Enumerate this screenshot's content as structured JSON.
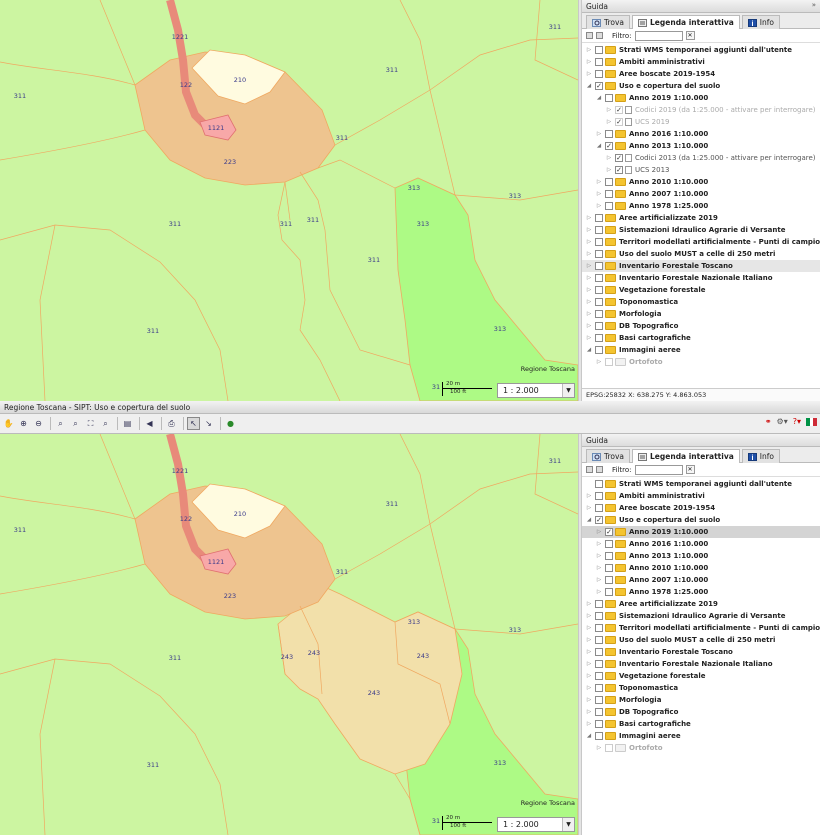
{
  "app_title": "Regione Toscana - SIPT: Uso e copertura del suolo",
  "panel": {
    "title": "Guida",
    "collapse_glyph": "»",
    "tabs": [
      {
        "label": "Trova",
        "icon": "search-icon"
      },
      {
        "label": "Legenda interattiva",
        "icon": "legend-icon",
        "active": true
      },
      {
        "label": "Info",
        "icon": "info-icon"
      }
    ],
    "filter_label": "Filtro:",
    "filter_value": ""
  },
  "map": {
    "credit": "Regione Toscana",
    "scale_m": "20 m",
    "scale_ft": "100 ft",
    "scale_value": "1 : 2.000",
    "colors": {
      "background": "#ccf5a1",
      "code_311": "#ccf5a1",
      "code_313": "#adfa85",
      "code_223": "#eec48f",
      "code_210": "#fffbe0",
      "code_1121": "#f8a8a8",
      "code_122": "#e88a7a",
      "code_243": "#f2e0aa",
      "border": "#f0a860"
    }
  },
  "top": {
    "map_codes": [
      "1221",
      "122",
      "210",
      "1121",
      "223",
      "311",
      "311",
      "311",
      "311",
      "311",
      "311",
      "311",
      "311",
      "311",
      "313",
      "313",
      "313",
      "31"
    ],
    "tree": [
      {
        "label": "Strati WMS temporanei aggiunti dall'utente",
        "level": 0,
        "exp": "▷",
        "check": false
      },
      {
        "label": "Ambiti amministrativi",
        "level": 0,
        "exp": "▷",
        "check": false
      },
      {
        "label": "Aree boscate 2019-1954",
        "level": 0,
        "exp": "▷",
        "check": false
      },
      {
        "label": "Uso e copertura del suolo",
        "level": 0,
        "exp": "◢",
        "check": true
      },
      {
        "label": "Anno 2019 1:10.000",
        "level": 1,
        "exp": "◢",
        "check": false
      },
      {
        "label": "Codici 2019 (da 1:25.000 - attivare per interrogare)",
        "level": 2,
        "exp": "▷",
        "check": true,
        "sub": true,
        "grey": true,
        "doc": true
      },
      {
        "label": "UCS 2019",
        "level": 2,
        "exp": "▷",
        "check": true,
        "sub": true,
        "grey": true,
        "doc": true
      },
      {
        "label": "Anno 2016 1:10.000",
        "level": 1,
        "exp": "▷",
        "check": false
      },
      {
        "label": "Anno 2013 1:10.000",
        "level": 1,
        "exp": "◢",
        "check": true
      },
      {
        "label": "Codici 2013 (da 1:25.000 - attivare per interrogare)",
        "level": 2,
        "exp": "▷",
        "check": true,
        "sub": true,
        "doc": true
      },
      {
        "label": "UCS 2013",
        "level": 2,
        "exp": "▷",
        "check": true,
        "sub": true,
        "doc": true
      },
      {
        "label": "Anno 2010 1:10.000",
        "level": 1,
        "exp": "▷",
        "check": false
      },
      {
        "label": "Anno 2007 1:10.000",
        "level": 1,
        "exp": "▷",
        "check": false
      },
      {
        "label": "Anno 1978 1:25.000",
        "level": 1,
        "exp": "▷",
        "check": false
      },
      {
        "label": "Aree artificializzate 2019",
        "level": 0,
        "exp": "▷",
        "check": false
      },
      {
        "label": "Sistemazioni Idraulico Agrarie di Versante",
        "level": 0,
        "exp": "▷",
        "check": false
      },
      {
        "label": "Territori modellati artificialmente - Punti di campionamento",
        "level": 0,
        "exp": "▷",
        "check": false
      },
      {
        "label": "Uso del suolo MUST a celle di 250 metri",
        "level": 0,
        "exp": "▷",
        "check": false
      },
      {
        "label": "Inventario Forestale Toscano",
        "level": 0,
        "exp": "▷",
        "check": false,
        "hl": true
      },
      {
        "label": "Inventario Forestale Nazionale Italiano",
        "level": 0,
        "exp": "▷",
        "check": false
      },
      {
        "label": "Vegetazione forestale",
        "level": 0,
        "exp": "▷",
        "check": false
      },
      {
        "label": "Toponomastica",
        "level": 0,
        "exp": "▷",
        "check": false
      },
      {
        "label": "Morfologia",
        "level": 0,
        "exp": "▷",
        "check": false
      },
      {
        "label": "DB Topografico",
        "level": 0,
        "exp": "▷",
        "check": false
      },
      {
        "label": "Basi cartografiche",
        "level": 0,
        "exp": "▷",
        "check": false
      },
      {
        "label": "Immagini aeree",
        "level": 0,
        "exp": "◢",
        "check": false
      },
      {
        "label": "Ortofoto",
        "level": 1,
        "exp": "▷",
        "check": false,
        "grey": true
      }
    ],
    "coords_text": "EPSG:25832  X: 638.275  Y: 4.863.053"
  },
  "bottom": {
    "map_codes": [
      "1221",
      "122",
      "210",
      "1121",
      "223",
      "311",
      "311",
      "311",
      "311",
      "311",
      "311",
      "313",
      "313",
      "313",
      "243",
      "243",
      "243",
      "243",
      "31"
    ],
    "tree": [
      {
        "label": "Strati WMS temporanei aggiunti dall'utente",
        "level": 0,
        "exp": "",
        "check": false
      },
      {
        "label": "Ambiti amministrativi",
        "level": 0,
        "exp": "▷",
        "check": false
      },
      {
        "label": "Aree boscate 2019-1954",
        "level": 0,
        "exp": "▷",
        "check": false
      },
      {
        "label": "Uso e copertura del suolo",
        "level": 0,
        "exp": "◢",
        "check": true
      },
      {
        "label": "Anno 2019 1:10.000",
        "level": 1,
        "exp": "▷",
        "check": true,
        "sel": true
      },
      {
        "label": "Anno 2016 1:10.000",
        "level": 1,
        "exp": "▷",
        "check": false
      },
      {
        "label": "Anno 2013 1:10.000",
        "level": 1,
        "exp": "▷",
        "check": false
      },
      {
        "label": "Anno 2010 1:10.000",
        "level": 1,
        "exp": "▷",
        "check": false
      },
      {
        "label": "Anno 2007 1:10.000",
        "level": 1,
        "exp": "▷",
        "check": false
      },
      {
        "label": "Anno 1978 1:25.000",
        "level": 1,
        "exp": "▷",
        "check": false
      },
      {
        "label": "Aree artificializzate 2019",
        "level": 0,
        "exp": "▷",
        "check": false
      },
      {
        "label": "Sistemazioni Idraulico Agrarie di Versante",
        "level": 0,
        "exp": "▷",
        "check": false
      },
      {
        "label": "Territori modellati artificialmente - Punti di campionamento",
        "level": 0,
        "exp": "▷",
        "check": false
      },
      {
        "label": "Uso del suolo MUST a celle di 250 metri",
        "level": 0,
        "exp": "▷",
        "check": false
      },
      {
        "label": "Inventario Forestale Toscano",
        "level": 0,
        "exp": "▷",
        "check": false
      },
      {
        "label": "Inventario Forestale Nazionale Italiano",
        "level": 0,
        "exp": "▷",
        "check": false
      },
      {
        "label": "Vegetazione forestale",
        "level": 0,
        "exp": "▷",
        "check": false
      },
      {
        "label": "Toponomastica",
        "level": 0,
        "exp": "▷",
        "check": false
      },
      {
        "label": "Morfologia",
        "level": 0,
        "exp": "▷",
        "check": false
      },
      {
        "label": "DB Topografico",
        "level": 0,
        "exp": "▷",
        "check": false
      },
      {
        "label": "Basi cartografiche",
        "level": 0,
        "exp": "▷",
        "check": false
      },
      {
        "label": "Immagini aeree",
        "level": 0,
        "exp": "◢",
        "check": false
      },
      {
        "label": "Ortofoto",
        "level": 1,
        "exp": "▷",
        "check": false,
        "grey": true
      }
    ]
  },
  "toolbar": {
    "tools": [
      "hand-icon",
      "zoom-in-icon",
      "zoom-out-icon",
      "zoom-box-in-icon",
      "zoom-box-out-icon",
      "zoom-extent-icon",
      "zoom-previous-icon",
      "print-menu-icon",
      "back-icon",
      "print-icon",
      "identify-icon",
      "measure-icon",
      "globe-icon"
    ],
    "right_tools": [
      "link-icon",
      "settings-icon",
      "help-icon",
      "language-flag-icon"
    ]
  }
}
